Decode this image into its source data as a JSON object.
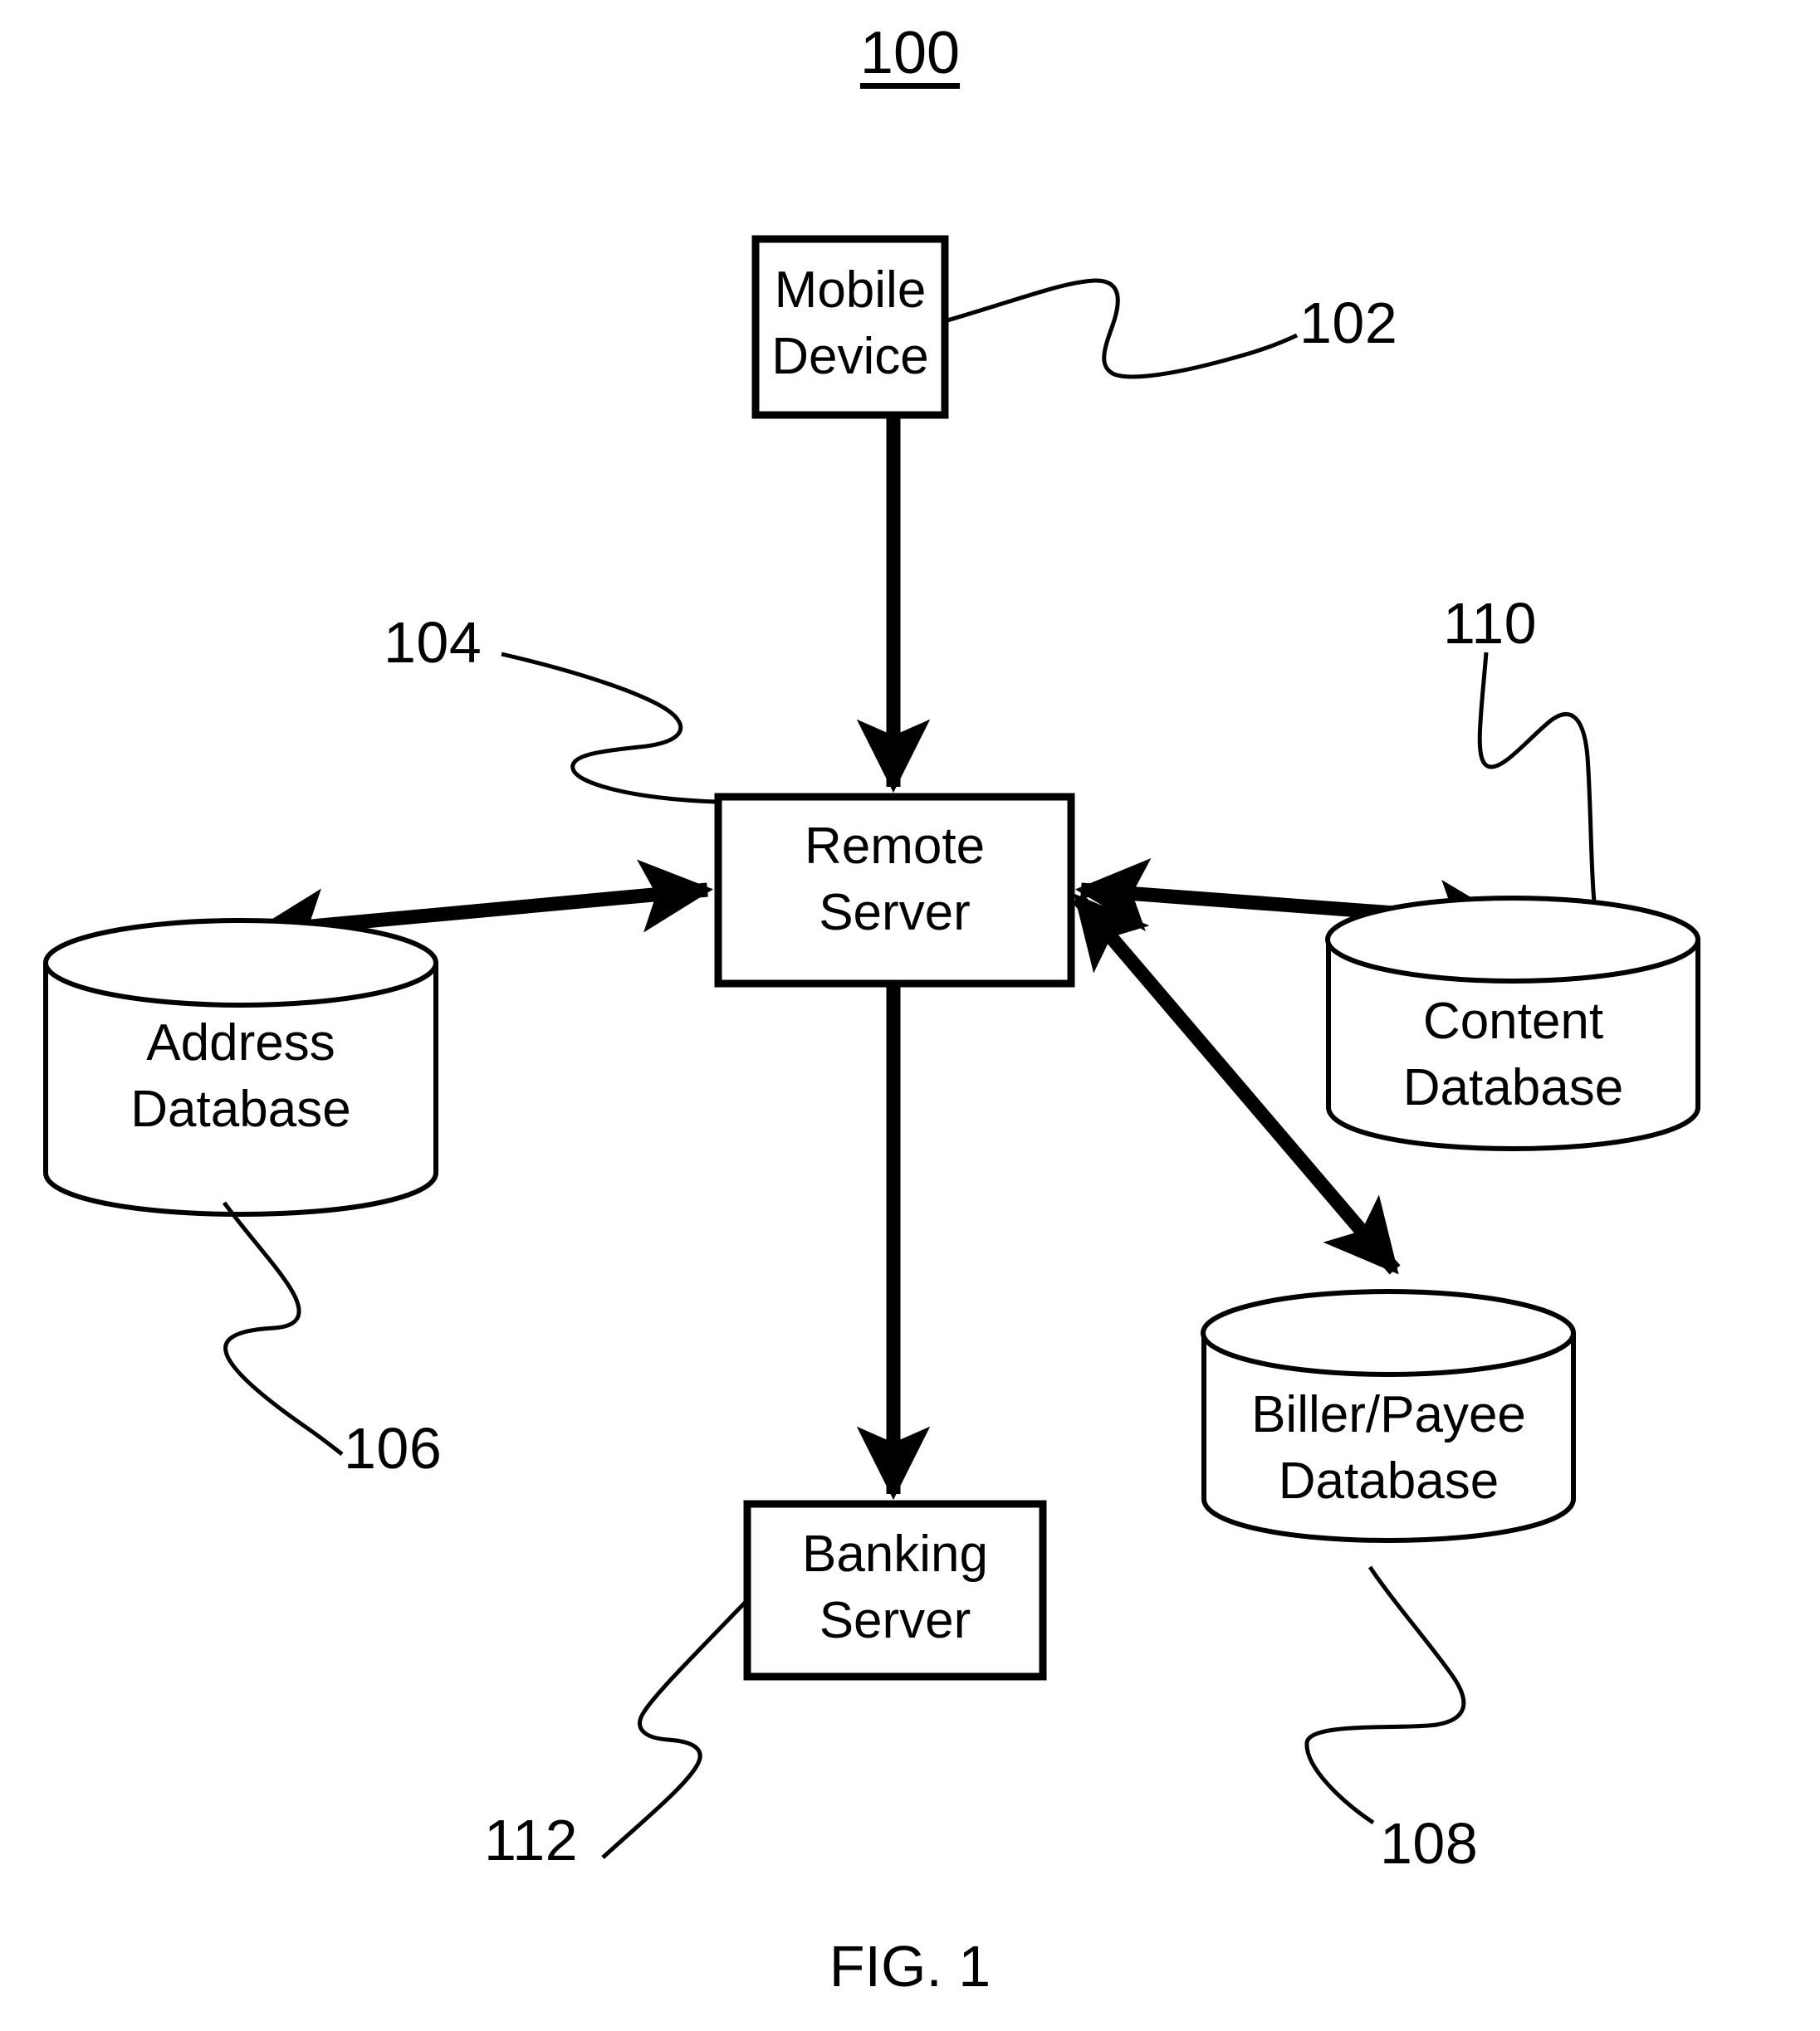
{
  "figure": {
    "title_number": "100",
    "caption": "FIG. 1"
  },
  "nodes": {
    "mobile_device": {
      "line1": "Mobile",
      "line2": "Device",
      "ref": "102",
      "shape": "rectangle"
    },
    "remote_server": {
      "line1": "Remote",
      "line2": "Server",
      "ref": "104",
      "shape": "rectangle"
    },
    "address_database": {
      "line1": "Address",
      "line2": "Database",
      "ref": "106",
      "shape": "cylinder"
    },
    "content_database": {
      "line1": "Content",
      "line2": "Database",
      "ref": "110",
      "shape": "cylinder"
    },
    "biller_payee_database": {
      "line1": "Biller/Payee",
      "line2": "Database",
      "ref": "108",
      "shape": "cylinder"
    },
    "banking_server": {
      "line1": "Banking",
      "line2": "Server",
      "ref": "112",
      "shape": "rectangle"
    }
  },
  "connections": [
    {
      "from": "mobile_device",
      "to": "remote_server",
      "style": "arrow-down"
    },
    {
      "from": "remote_server",
      "to": "address_database",
      "style": "double-arrow"
    },
    {
      "from": "remote_server",
      "to": "content_database",
      "style": "double-arrow"
    },
    {
      "from": "remote_server",
      "to": "biller_payee_database",
      "style": "double-arrow"
    },
    {
      "from": "remote_server",
      "to": "banking_server",
      "style": "arrow-down"
    }
  ],
  "colors": {
    "stroke": "#000000",
    "background": "#ffffff"
  }
}
